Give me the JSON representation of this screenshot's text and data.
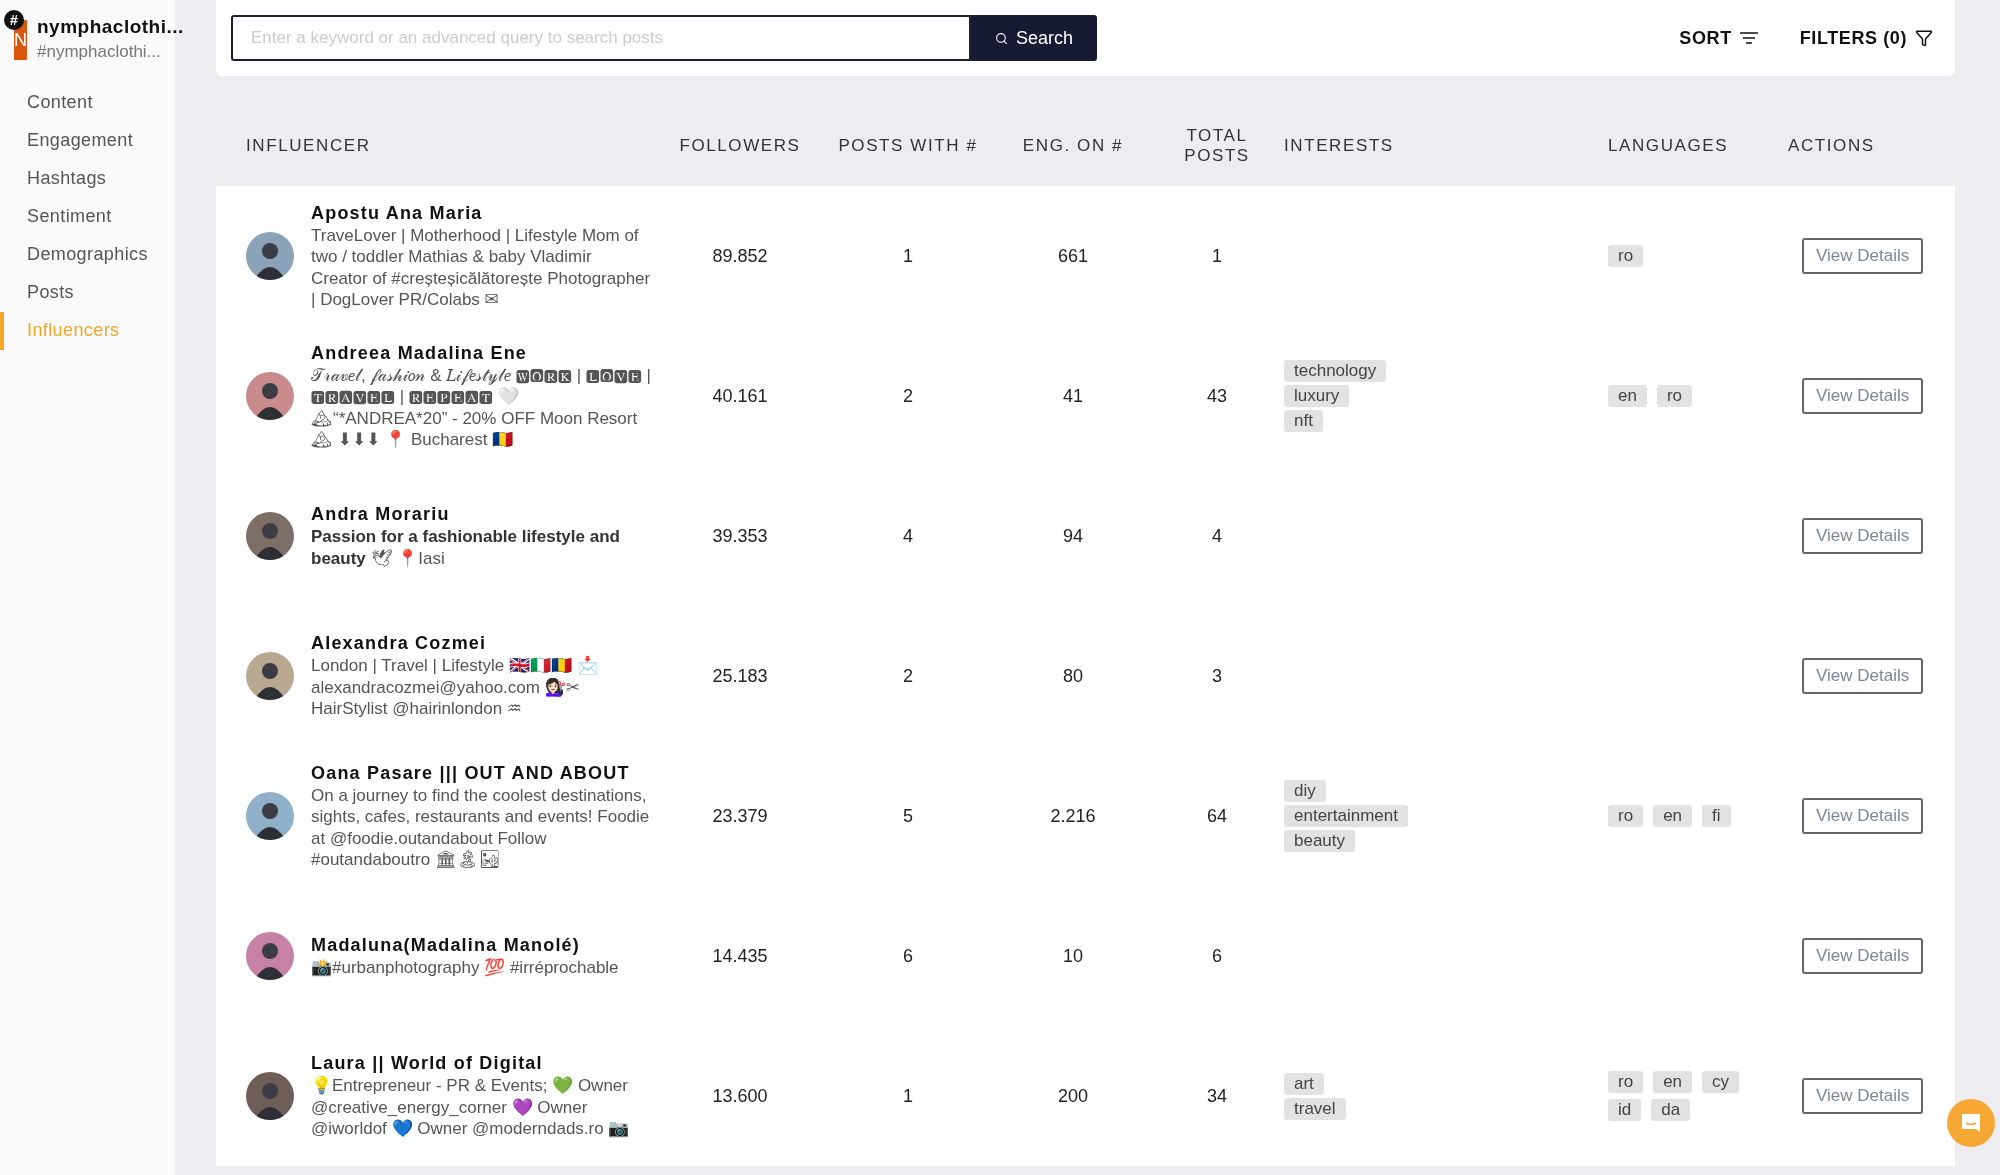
{
  "account": {
    "logo_letter": "N",
    "badge": "#",
    "name": "nymphaclothi...",
    "handle": "#nymphaclothi..."
  },
  "sidebar": {
    "items": [
      {
        "label": "Content",
        "selected": false
      },
      {
        "label": "Engagement",
        "selected": false
      },
      {
        "label": "Hashtags",
        "selected": false
      },
      {
        "label": "Sentiment",
        "selected": false
      },
      {
        "label": "Demographics",
        "selected": false
      },
      {
        "label": "Posts",
        "selected": false
      },
      {
        "label": "Influencers",
        "selected": true
      }
    ]
  },
  "search": {
    "placeholder": "Enter a keyword or an advanced query to search posts",
    "button": "Search"
  },
  "toolbar": {
    "sort": "SORT",
    "filters": "FILTERS (0)"
  },
  "table": {
    "columns": [
      "INFLUENCER",
      "FOLLOWERS",
      "POSTS WITH #",
      "ENG. ON #",
      "TOTAL POSTS",
      "INTERESTS",
      "LANGUAGES",
      "ACTIONS"
    ],
    "rows": [
      {
        "name": "Apostu Ana Maria",
        "bio": "TraveLover | Motherhood | Lifestyle Mom of two / toddler Mathias & baby Vladimir Creator of #creșteșicălătorește Photographer | DogLover PR/Colabs ✉",
        "followers": "89.852",
        "posts_with": "1",
        "eng_on": "661",
        "total_posts": "1",
        "interests": [],
        "languages": [
          "ro"
        ],
        "action": "View Details"
      },
      {
        "name": "Andreea Madalina Ene",
        "bio": "𝒯𝓇𝒶𝓋𝑒𝓁, 𝒻𝒶𝓈𝒽𝒾𝑜𝓃 & 𝐿𝒾𝒻𝑒𝓈𝓉𝓎𝓁𝑒 🆆🅾🆁🅺 | 🅻🅾🆅🅴 | 🆃🆁🅰🆅🅴🅻 | 🆁🅴🅿🅴🅰🆃 🤍 🏔“*ANDREA*20” - 20% OFF Moon Resort🏔 ⬇⬇⬇ 📍 Bucharest 🇷🇴",
        "followers": "40.161",
        "posts_with": "2",
        "eng_on": "41",
        "total_posts": "43",
        "interests": [
          "technology",
          "luxury",
          "nft"
        ],
        "languages": [
          "en",
          "ro"
        ],
        "action": "View Details"
      },
      {
        "name": "Andra Morariu",
        "bio": "**Passion for a fashionable lifestyle and beauty** 🕊 📍Iasi",
        "followers": "39.353",
        "posts_with": "4",
        "eng_on": "94",
        "total_posts": "4",
        "interests": [],
        "languages": [],
        "action": "View Details"
      },
      {
        "name": "Alexandra Cozmei",
        "bio": "London | Travel | Lifestyle 🇬🇧🇮🇹🇷🇴 📩 alexandracozmei@yahoo.com 💇🏻‍♀️✂ HairStylist @hairinlondon ♒",
        "followers": "25.183",
        "posts_with": "2",
        "eng_on": "80",
        "total_posts": "3",
        "interests": [],
        "languages": [],
        "action": "View Details"
      },
      {
        "name": "Oana Pasare ||| OUT AND ABOUT",
        "bio": "On a journey to find the coolest destinations, sights, cafes, restaurants and events! Foodie at @foodie.outandabout Follow #outandaboutro 🏛🏝🏜",
        "followers": "23.379",
        "posts_with": "5",
        "eng_on": "2.216",
        "total_posts": "64",
        "interests": [
          "diy",
          "entertainment",
          "beauty"
        ],
        "languages": [
          "ro",
          "en",
          "fi"
        ],
        "action": "View Details"
      },
      {
        "name": "Madaluna(Madalina Manolé)",
        "bio": "📸#urbanphotography 💯 #irréprochable",
        "followers": "14.435",
        "posts_with": "6",
        "eng_on": "10",
        "total_posts": "6",
        "interests": [],
        "languages": [],
        "action": "View Details"
      },
      {
        "name": "Laura || World of Digital",
        "bio": "💡Entrepreneur - PR & Events; 💚 Owner @creative_energy_corner 💜 Owner @iworldof 💙 Owner @moderndads.ro 📷",
        "followers": "13.600",
        "posts_with": "1",
        "eng_on": "200",
        "total_posts": "34",
        "interests": [
          "art",
          "travel"
        ],
        "languages": [
          "ro",
          "en",
          "cy",
          "id",
          "da"
        ],
        "action": "View Details"
      }
    ]
  }
}
